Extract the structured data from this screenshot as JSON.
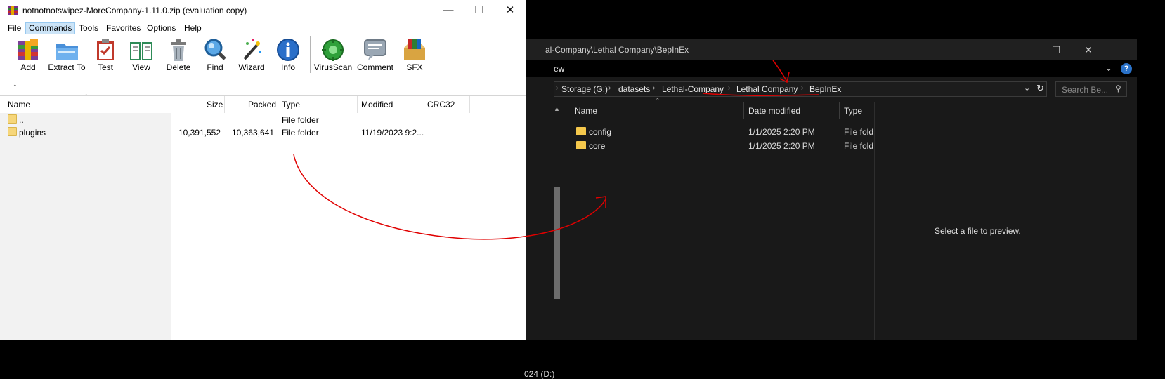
{
  "explorer": {
    "title": "al-Company\\Lethal Company\\BepInEx",
    "ribbon_view": "ew",
    "help_glyph": "?",
    "breadcrumb": [
      "Storage (G:)",
      "datasets",
      "Lethal-Company",
      "Lethal Company",
      "BepInEx"
    ],
    "search_placeholder": "Search Be...",
    "nav_drive": "024 (D:)",
    "columns": [
      "Name",
      "Date modified",
      "Type"
    ],
    "rows": [
      {
        "name": "config",
        "date": "1/1/2025 2:20 PM",
        "type": "File fold"
      },
      {
        "name": "core",
        "date": "1/1/2025 2:20 PM",
        "type": "File fold"
      }
    ],
    "preview_text": "Select a file to preview."
  },
  "winrar": {
    "title": "notnotnotswipez-MoreCompany-1.11.0.zip (evaluation copy)",
    "menu": [
      "File",
      "Commands",
      "Tools",
      "Favorites",
      "Options",
      "Help"
    ],
    "toolbar": [
      "Add",
      "Extract To",
      "Test",
      "View",
      "Delete",
      "Find",
      "Wizard",
      "Info",
      "VirusScan",
      "Comment",
      "SFX"
    ],
    "columns": [
      "Name",
      "Size",
      "Packed",
      "Type",
      "Modified",
      "CRC32"
    ],
    "rows": [
      {
        "name": "..",
        "size": "",
        "packed": "",
        "type": "File folder",
        "modified": "",
        "crc": ""
      },
      {
        "name": "plugins",
        "size": "10,391,552",
        "packed": "10,363,641",
        "type": "File folder",
        "modified": "11/19/2023 9:2...",
        "crc": ""
      }
    ]
  },
  "colors": {
    "annotation_red": "#e00000",
    "dark_bg": "#191919",
    "folder_yellow": "#f5c84c"
  }
}
